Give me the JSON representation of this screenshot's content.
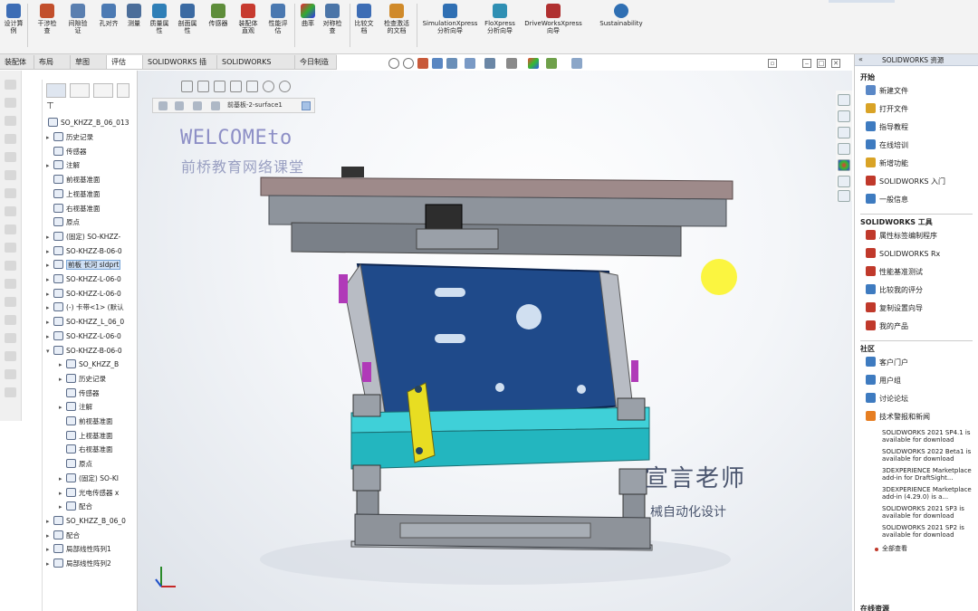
{
  "ribbon": {
    "groups": [
      {
        "label": "设计算\n例",
        "icon": "design-study-icon",
        "color": "#3d6db5"
      },
      {
        "label": "干涉检\n查",
        "icon": "interference-icon",
        "color": "#c24f2c"
      },
      {
        "label": "间隙验\n证",
        "icon": "clearance-icon",
        "color": "#5a7fb0"
      },
      {
        "label": "孔对齐",
        "icon": "hole-align-icon",
        "color": "#4c7ab3"
      },
      {
        "label": "测量",
        "icon": "measure-icon",
        "color": "#4c6e9a"
      },
      {
        "label": "质量属\n性",
        "icon": "mass-props-icon",
        "color": "#2f7fb7"
      },
      {
        "label": "剖面属\n性",
        "icon": "section-props-icon",
        "color": "#3b6aa2"
      },
      {
        "label": "传感器",
        "icon": "sensor-icon",
        "color": "#5e8d3a"
      },
      {
        "label": "装配体\n直观",
        "icon": "assembly-visualization-icon",
        "color": "#c73a2f"
      },
      {
        "label": "性能评\n估",
        "icon": "performance-icon",
        "color": "#4a78b0"
      },
      {
        "label": "曲率",
        "icon": "curvature-icon",
        "color": "#8c3fb0"
      },
      {
        "label": "对称检\n查",
        "icon": "symmetry-icon",
        "color": "#4b75a8"
      },
      {
        "label": "比较文\n档",
        "icon": "compare-docs-icon",
        "color": "#3d6db5"
      },
      {
        "label": "检查激活\n的文档",
        "icon": "check-doc-icon",
        "color": "#d08a2a"
      },
      {
        "label": "SimulationXpress\n分析向导",
        "icon": "simulationxpress-icon",
        "color": "#2f6fb3"
      },
      {
        "label": "FloXpress\n分析向导",
        "icon": "floxpress-icon",
        "color": "#2f8fb3"
      },
      {
        "label": "DriveWorksXpress\n向导",
        "icon": "driveworksxpress-icon",
        "color": "#b03030"
      },
      {
        "label": "Sustainability",
        "icon": "sustainability-icon",
        "color": "#2f6fb3"
      }
    ]
  },
  "cm_tabs": [
    "装配体",
    "布局",
    "草图",
    "评估",
    "SOLIDWORKS 插件",
    "SOLIDWORKS MBD",
    "今日制造"
  ],
  "cm_active": 3,
  "breadcrumb": {
    "text": "前基板-2-surface1"
  },
  "watermark": {
    "line1": "WELCOMEto",
    "line2": "前桥教育网络课堂",
    "teacher": "宣言老师",
    "teacher_sub": "械自动化设计"
  },
  "feature_tree": {
    "root": "SO_KHZZ_B_06_013",
    "items": [
      {
        "label": "历史记录",
        "indent": 1,
        "exp": "▸"
      },
      {
        "label": "传感器",
        "indent": 1,
        "exp": ""
      },
      {
        "label": "注解",
        "indent": 1,
        "exp": "▸"
      },
      {
        "label": "前视基准面",
        "indent": 1,
        "exp": ""
      },
      {
        "label": "上视基准面",
        "indent": 1,
        "exp": ""
      },
      {
        "label": "右视基准面",
        "indent": 1,
        "exp": ""
      },
      {
        "label": "原点",
        "indent": 1,
        "exp": ""
      },
      {
        "label": "(固定) SO-KHZZ-",
        "indent": 1,
        "exp": "▸"
      },
      {
        "label": "SO-KHZZ-B-06-0",
        "indent": 1,
        "exp": "▸"
      },
      {
        "label": "前板 长河 sldprt",
        "indent": 1,
        "exp": "▸",
        "sel": true
      },
      {
        "label": "SO-KHZZ-L-06-0",
        "indent": 1,
        "exp": "▸"
      },
      {
        "label": "SO-KHZZ-L-06-0",
        "indent": 1,
        "exp": "▸"
      },
      {
        "label": "(-) 卡带<1> (默认",
        "indent": 1,
        "exp": "▸"
      },
      {
        "label": "SO-KHZZ_L_06_0",
        "indent": 1,
        "exp": "▸"
      },
      {
        "label": "SO-KHZZ-L-06-0",
        "indent": 1,
        "exp": "▸"
      },
      {
        "label": "SO-KHZZ-B-06-0",
        "indent": 1,
        "exp": "▾"
      },
      {
        "label": "SO_KHZZ_B",
        "indent": 2,
        "exp": "▸"
      },
      {
        "label": "历史记录",
        "indent": 2,
        "exp": "▸"
      },
      {
        "label": "传感器",
        "indent": 2,
        "exp": ""
      },
      {
        "label": "注解",
        "indent": 2,
        "exp": "▸"
      },
      {
        "label": "前视基准面",
        "indent": 2,
        "exp": ""
      },
      {
        "label": "上视基准面",
        "indent": 2,
        "exp": ""
      },
      {
        "label": "右视基准面",
        "indent": 2,
        "exp": ""
      },
      {
        "label": "原点",
        "indent": 2,
        "exp": ""
      },
      {
        "label": "(固定) SO-KI",
        "indent": 2,
        "exp": "▸"
      },
      {
        "label": "光电传感器 x",
        "indent": 2,
        "exp": "▸"
      },
      {
        "label": "配合",
        "indent": 2,
        "exp": "▸"
      },
      {
        "label": "SO_KHZZ_B_06_0",
        "indent": 1,
        "exp": "▸"
      },
      {
        "label": "配合",
        "indent": 1,
        "exp": "▸"
      },
      {
        "label": "局部线性阵列1",
        "indent": 1,
        "exp": "▸"
      },
      {
        "label": "局部线性阵列2",
        "indent": 1,
        "exp": "▸"
      }
    ]
  },
  "task_pane": {
    "title": "SOLIDWORKS 资源",
    "sections": [
      {
        "title": "开始",
        "items": [
          {
            "label": "新建文件",
            "icon": "new-file-icon",
            "color": "#5a88c7"
          },
          {
            "label": "打开文件",
            "icon": "open-file-icon",
            "color": "#d9a326"
          },
          {
            "label": "指导教程",
            "icon": "tutorial-icon",
            "color": "#3e7bc0"
          },
          {
            "label": "在线培训",
            "icon": "online-training-icon",
            "color": "#3e7bc0"
          },
          {
            "label": "新增功能",
            "icon": "whats-new-icon",
            "color": "#d9a326"
          },
          {
            "label": "SOLIDWORKS 入门",
            "icon": "intro-icon",
            "color": "#c0392b"
          },
          {
            "label": "一般信息",
            "icon": "info-icon",
            "color": "#3e7bc0"
          }
        ]
      },
      {
        "title": "SOLIDWORKS 工具",
        "items": [
          {
            "label": "属性标签编制程序",
            "icon": "property-tab-icon",
            "color": "#c0392b"
          },
          {
            "label": "SOLIDWORKS Rx",
            "icon": "rx-icon",
            "color": "#c0392b"
          },
          {
            "label": "性能基准测试",
            "icon": "benchmark-icon",
            "color": "#c0392b"
          },
          {
            "label": "比较我的评分",
            "icon": "compare-score-icon",
            "color": "#3e7bc0"
          },
          {
            "label": "复制设置向导",
            "icon": "copy-settings-icon",
            "color": "#c0392b"
          },
          {
            "label": "我的产品",
            "icon": "my-products-icon",
            "color": "#c0392b"
          }
        ]
      },
      {
        "title": "社区",
        "items": [
          {
            "label": "客户门户",
            "icon": "customer-portal-icon",
            "color": "#3e7bc0"
          },
          {
            "label": "用户组",
            "icon": "user-group-icon",
            "color": "#3e7bc0"
          },
          {
            "label": "讨论论坛",
            "icon": "forum-icon",
            "color": "#3e7bc0"
          },
          {
            "label": "技术警报和新闻",
            "icon": "rss-icon",
            "color": "#e67e22"
          }
        ]
      }
    ],
    "news": [
      "SOLIDWORKS 2021 SP4.1 is available for download",
      "SOLIDWORKS 2022 Beta1 is available for download",
      "3DEXPERIENCE Marketplace add-in for DraftSight...",
      "3DEXPERIENCE Marketplace add-in (4.29.0) is a...",
      "SOLIDWORKS 2021 SP3 is available for download",
      "SOLIDWORKS 2021 SP2 is available for download"
    ],
    "all_topics": "全部查看",
    "bottom": "在线资源"
  }
}
